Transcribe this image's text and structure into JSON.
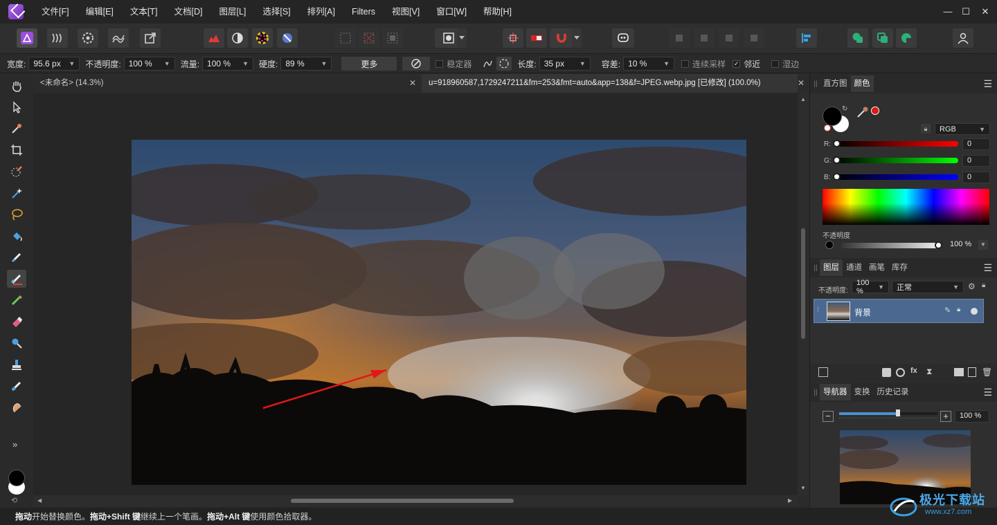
{
  "menu": [
    "文件[F]",
    "编辑[E]",
    "文本[T]",
    "文档[D]",
    "图层[L]",
    "选择[S]",
    "排列[A]",
    "Filters",
    "视图[V]",
    "窗口[W]",
    "帮助[H]"
  ],
  "window_controls": {
    "minimize": "—",
    "maximize": "☐",
    "close": "✕"
  },
  "context": {
    "width_label": "宽度:",
    "width_value": "95.6 px",
    "opacity_label": "不透明度:",
    "opacity_value": "100 %",
    "flow_label": "流量:",
    "flow_value": "100 %",
    "hardness_label": "硬度:",
    "hardness_value": "89 %",
    "more_label": "更多",
    "stabilizer_label": "稳定器",
    "length_label": "长度:",
    "length_value": "35 px",
    "tolerance_label": "容差:",
    "tolerance_value": "10 %",
    "continuous_label": "连续采样",
    "contiguous_label": "邻近",
    "antialias_label": "湿边"
  },
  "tabs": [
    {
      "label": "<未命名> (14.3%)"
    },
    {
      "label": "u=918960587,1729247211&fm=253&fmt=auto&app=138&f=JPEG.webp.jpg [已修改] (100.0%)"
    }
  ],
  "tab_close": "✕",
  "status": {
    "p1_bold": "拖动",
    "p1": " 开始替换颜色。",
    "p2_bold": "拖动+Shift 键",
    "p2": " 继续上一个笔画。",
    "p3_bold": "拖动+Alt 键",
    "p3": " 使用颜色拾取器。"
  },
  "color_panel": {
    "tabs": [
      "直方图",
      "颜色"
    ],
    "active_tab": "颜色",
    "mode": "RGB",
    "r_label": "R:",
    "g_label": "G:",
    "b_label": "B:",
    "r_value": "0",
    "g_value": "0",
    "b_value": "0",
    "opacity_label": "不透明度",
    "opacity_value": "100 %",
    "accent_color": "#e01818"
  },
  "layers_panel": {
    "tabs": [
      "图层",
      "通道",
      "画笔",
      "库存"
    ],
    "active_tab": "图层",
    "opacity_label": "不透明度:",
    "opacity_value": "100 %",
    "blend_mode": "正常",
    "layer_name": "背景"
  },
  "navigator_panel": {
    "tabs": [
      "导航器",
      "变换",
      "历史记录"
    ],
    "active_tab": "导航器",
    "zoom_value": "100 %",
    "zoom_fraction": 0.6
  },
  "watermark": {
    "title": "极光下载站",
    "url": "www.xz7.com"
  },
  "more_tools": "»"
}
